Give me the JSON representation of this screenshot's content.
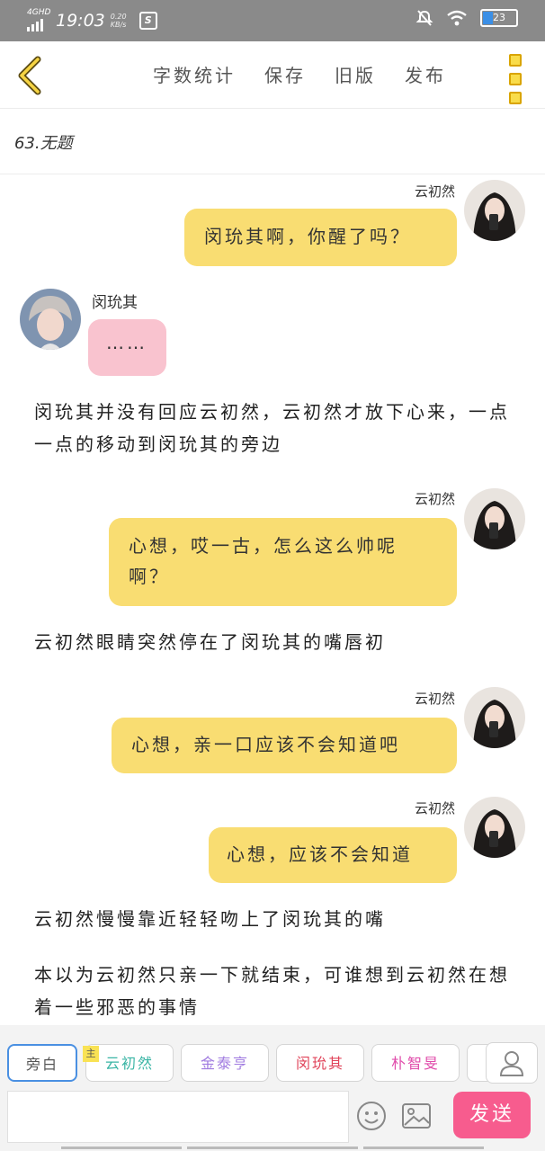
{
  "status_bar": {
    "network": "4GHD",
    "time": "19:03",
    "speed": "0.20",
    "speed_unit": "KB/s",
    "battery": "23"
  },
  "appbar": {
    "menu": [
      "字数统计",
      "保存",
      "旧版",
      "发布"
    ]
  },
  "story_title": "63.无题",
  "messages": [
    {
      "speaker": "云初然",
      "text": "闵玧其啊，你醒了吗？"
    },
    {
      "speaker": "闵玧其",
      "text": "……"
    },
    {
      "narration": "闵玧其并没有回应云初然，云初然才放下心来，一点一点的移动到闵玧其的旁边"
    },
    {
      "speaker": "云初然",
      "text": "心想，哎一古，怎么这么帅呢啊？"
    },
    {
      "narration": "云初然眼睛突然停在了闵玧其的嘴唇初"
    },
    {
      "speaker": "云初然",
      "text": "心想，亲一口应该不会知道吧"
    },
    {
      "speaker": "云初然",
      "text": "心想，应该不会知道"
    },
    {
      "narration": "云初然慢慢靠近轻轻吻上了闵玧其的嘴"
    },
    {
      "narration": "本以为云初然只亲一下就结束，可谁想到云初然在想着一些邪恶的事情"
    }
  ],
  "characters": {
    "narrator_label": "旁白",
    "main_tag": "主",
    "chips": [
      "云初然",
      "金泰亨",
      "闵玧其",
      "朴智旻"
    ],
    "chip_colors": [
      "#3ab5a5",
      "#a07be0",
      "#e0445a",
      "#e04dab"
    ]
  },
  "composer": {
    "send_label": "发送"
  },
  "colors": {
    "bubble_right": "#f9dd72",
    "bubble_left": "#f9c3cf",
    "send_button": "#f75c8e"
  }
}
